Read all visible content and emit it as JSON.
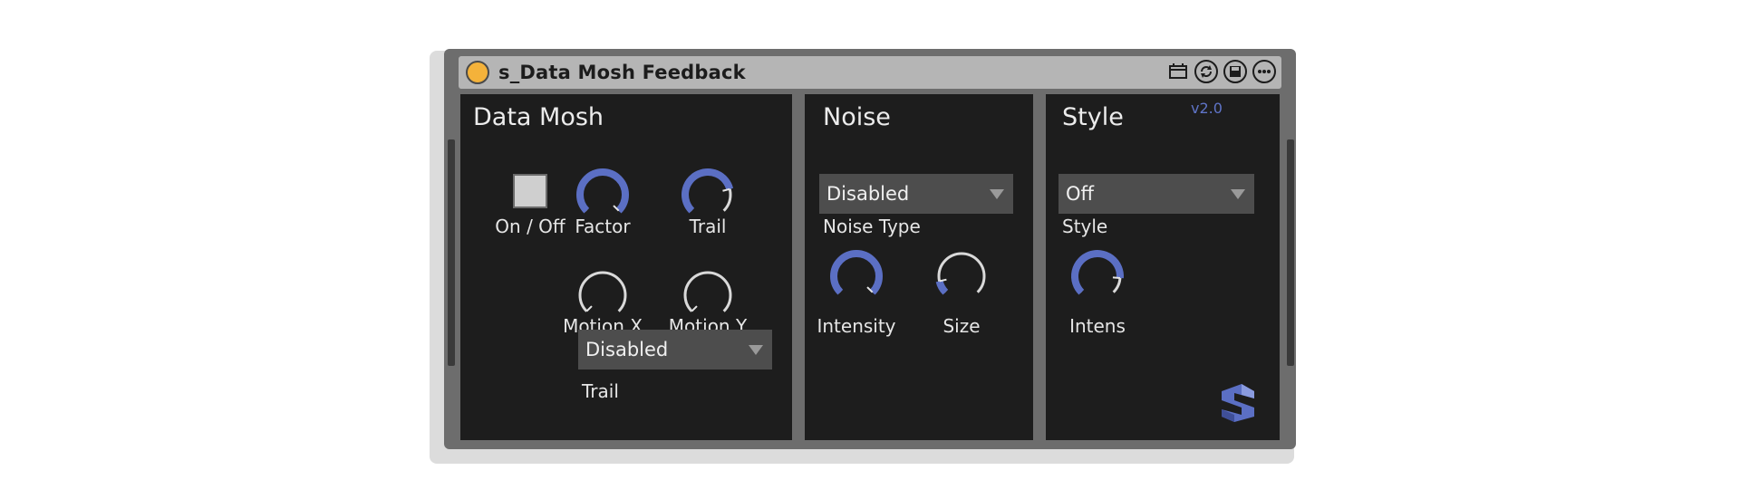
{
  "device": {
    "title": "s_Data Mosh Feedback",
    "version": "v2.0",
    "accent_color": "#5b6fc4",
    "power_color": "#f4b23a"
  },
  "titlebar_icons": [
    "calendar-icon",
    "refresh-icon",
    "save-icon",
    "more-icon"
  ],
  "data_mosh": {
    "title": "Data Mosh",
    "toggle_label": "On / Off",
    "factor_label": "Factor",
    "trail_label": "Trail",
    "motion_x_label": "Motion X",
    "motion_y_label": "Motion Y",
    "trail_dropdown_value": "Disabled",
    "trail_dropdown_label": "Trail",
    "knob_levels": {
      "factor": 1.0,
      "trail": 0.78,
      "motion_x": 0.0,
      "motion_y": 0.0
    }
  },
  "noise": {
    "title": "Noise",
    "type_dropdown_value": "Disabled",
    "type_label": "Noise Type",
    "intensity_label": "Intensity",
    "size_label": "Size",
    "knob_levels": {
      "intensity": 1.0,
      "size": 0.12
    }
  },
  "style": {
    "title": "Style",
    "style_dropdown_value": "Off",
    "style_label": "Style",
    "intens_label": "Intens",
    "knob_levels": {
      "intens": 0.85
    }
  }
}
